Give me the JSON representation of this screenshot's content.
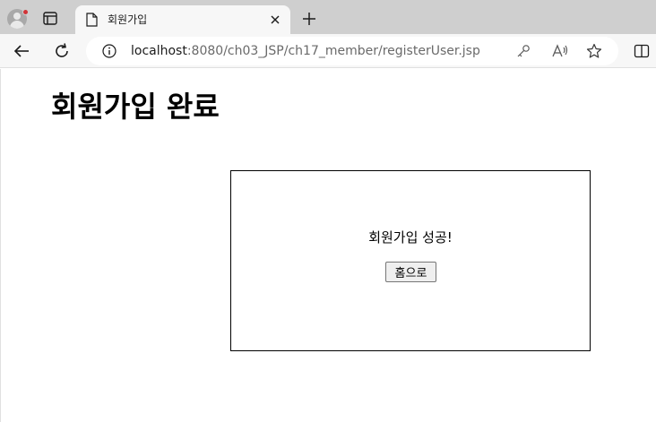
{
  "browser": {
    "tab": {
      "title": "회원가입"
    },
    "address": {
      "host": "localhost",
      "path": ":8080/ch03_JSP/ch17_member/registerUser.jsp"
    }
  },
  "page": {
    "heading": "회원가입 완료",
    "message": "회원가입 성공!",
    "home_button_label": "홈으로"
  },
  "colors": {
    "tabstrip": "#cfcfcf",
    "toolbar": "#f7f7f7",
    "notification_dot": "#d13438"
  }
}
